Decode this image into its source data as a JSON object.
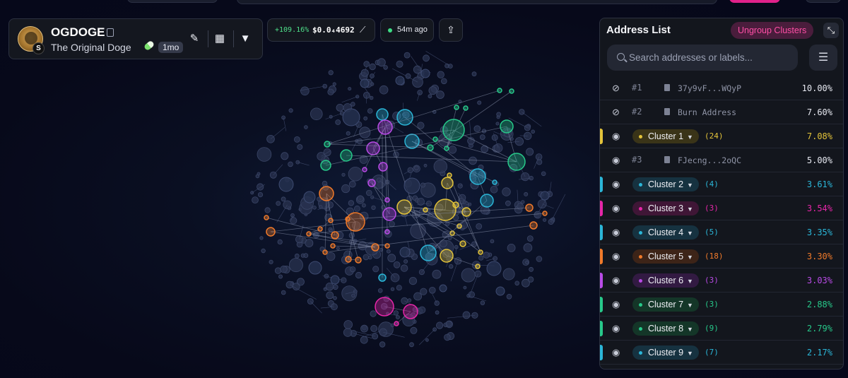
{
  "token": {
    "symbol": "OGDOGE",
    "name": "The Original Doge",
    "age": "1mo",
    "logo_badge": "S"
  },
  "price": {
    "change": "+109.16%",
    "value": "$0.0₄4692"
  },
  "updated": "54m ago",
  "panel": {
    "title": "Address List",
    "ungroup_label": "Ungroup Clusters",
    "search_placeholder": "Search addresses or labels..."
  },
  "rows": [
    {
      "type": "address",
      "rank": "#1",
      "address": "37y9vF...WQyP",
      "percent": "10.00%",
      "hidden": true
    },
    {
      "type": "address",
      "rank": "#2",
      "address": "Burn Address",
      "percent": "7.60%",
      "hidden": true
    },
    {
      "type": "cluster",
      "label": "Cluster 1",
      "count": "(24)",
      "percent": "7.08%",
      "color": "#e3c33a",
      "chip_bg": "#3a3418"
    },
    {
      "type": "address",
      "rank": "#3",
      "address": "FJecng...2oQC",
      "percent": "5.00%",
      "hidden": false
    },
    {
      "type": "cluster",
      "label": "Cluster 2",
      "count": "(4)",
      "percent": "3.61%",
      "color": "#2bb6d8",
      "chip_bg": "#163240"
    },
    {
      "type": "cluster",
      "label": "Cluster 3",
      "count": "(3)",
      "percent": "3.54%",
      "color": "#e626a8",
      "chip_bg": "#3f1636"
    },
    {
      "type": "cluster",
      "label": "Cluster 4",
      "count": "(5)",
      "percent": "3.35%",
      "color": "#2bb6d8",
      "chip_bg": "#163240"
    },
    {
      "type": "cluster",
      "label": "Cluster 5",
      "count": "(18)",
      "percent": "3.30%",
      "color": "#f07a2a",
      "chip_bg": "#3d2418"
    },
    {
      "type": "cluster",
      "label": "Cluster 6",
      "count": "(3)",
      "percent": "3.03%",
      "color": "#b94be6",
      "chip_bg": "#321a42"
    },
    {
      "type": "cluster",
      "label": "Cluster 7",
      "count": "(3)",
      "percent": "2.88%",
      "color": "#27c98a",
      "chip_bg": "#143628"
    },
    {
      "type": "cluster",
      "label": "Cluster 8",
      "count": "(9)",
      "percent": "2.79%",
      "color": "#27c98a",
      "chip_bg": "#143628"
    },
    {
      "type": "cluster",
      "label": "Cluster 9",
      "count": "(7)",
      "percent": "2.17%",
      "color": "#2bb6d8",
      "chip_bg": "#163240"
    }
  ],
  "colors": {
    "accent_pink": "#ff4fa6",
    "positive": "#4ee08a",
    "node_default": "#3a4460"
  },
  "icons": [
    "copy-icon",
    "pencil-icon",
    "calendar-icon",
    "filter-icon",
    "trend-icon",
    "share-icon",
    "eye-icon",
    "eye-off-icon",
    "document-icon",
    "search-icon",
    "sliders-icon",
    "collapse-icon",
    "chevron-down-icon"
  ]
}
